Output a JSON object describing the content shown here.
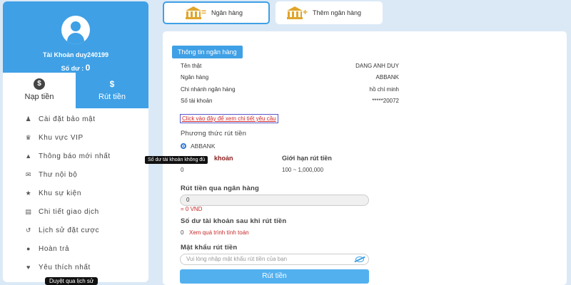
{
  "sidebar": {
    "account": "Tài Khoản duy240199",
    "balance_label": "Số dư : ",
    "balance_value": "0",
    "tabs": [
      {
        "label": "Nạp tiền",
        "icon": "coin-icon"
      },
      {
        "label": "Rút tiền",
        "icon": "hand-money-icon"
      }
    ],
    "menu": [
      {
        "label": "Cài đặt bảo mật",
        "icon": "user-settings-icon"
      },
      {
        "label": "Khu vực VIP",
        "icon": "crown-icon"
      },
      {
        "label": "Thông báo mới nhất",
        "icon": "megaphone-icon"
      },
      {
        "label": "Thư nội bộ",
        "icon": "envelope-icon"
      },
      {
        "label": "Khu sự kiện",
        "icon": "trophy-icon"
      },
      {
        "label": "Chi tiết giao dịch",
        "icon": "clipboard-icon"
      },
      {
        "label": "Lịch sử đặt cược",
        "icon": "history-icon"
      },
      {
        "label": "Hoàn trả",
        "icon": "refund-icon"
      },
      {
        "label": "Yêu thích nhất",
        "icon": "heart-icon"
      }
    ]
  },
  "tooltips": {
    "balance_insufficient": "Số dư tài khoản không đủ",
    "history": "Duyệt qua lịch sử"
  },
  "bank_tabs": {
    "bank": "Ngân hàng",
    "add_bank": "Thêm ngân hàng"
  },
  "bank_info": {
    "title": "Thông tin ngân hàng",
    "rows": [
      {
        "label": "Tên thật",
        "value": "DANG ANH DUY"
      },
      {
        "label": "Ngân hàng",
        "value": "ABBANK"
      },
      {
        "label": "Chi nhánh ngân hàng",
        "value": "hồ chí minh"
      },
      {
        "label": "Số tài khoản",
        "value": "*****20072"
      }
    ],
    "detail_link": "Click vào đây để xem chi tiết yêu cầu"
  },
  "withdraw": {
    "method_label": "Phương thức rút tiền",
    "method_option": "ABBANK",
    "col_account_label": "khoản",
    "col_limit_label": "Giới hạn rút tiền",
    "account_value": "0",
    "limit_value": "100 ~ 1,000,000",
    "bank_withdraw_label": "Rút tiền qua ngân hàng",
    "amount_value": "0",
    "amount_vnd": "= 0 VND",
    "balance_after_label": "Số dư tài khoản sau khi rút tiền",
    "balance_after_value": "0",
    "view_calc_link": "Xem quá trình tính toán",
    "password_label": "Mật khẩu rút tiền",
    "password_placeholder": "Vui lòng nhập mật khẩu rút tiền của bạn",
    "submit": "Rút tiền"
  },
  "colors": {
    "primary": "#3fa0e5",
    "button": "#52b0ef",
    "bank_icon": "#e0a52a",
    "link_red": "#d12b2b",
    "background": "#dbe9f6"
  }
}
